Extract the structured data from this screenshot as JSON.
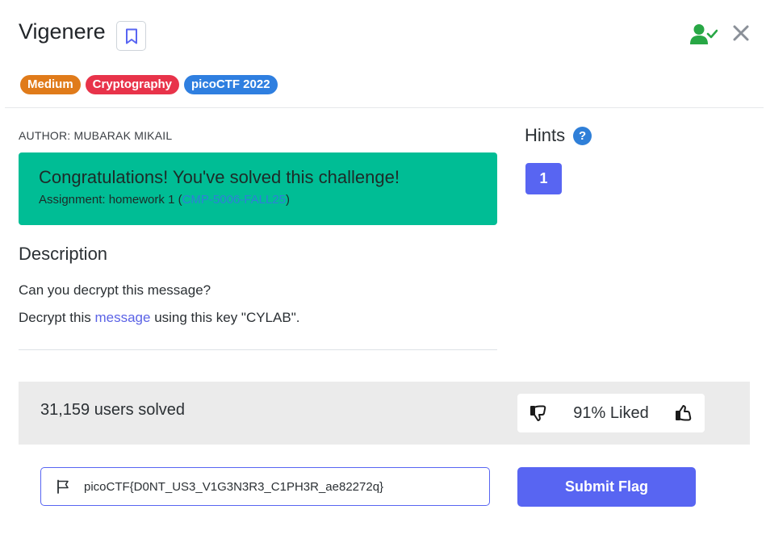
{
  "challenge": {
    "title": "Vigenere",
    "tags": [
      {
        "label": "Medium",
        "color": "#e07b1a"
      },
      {
        "label": "Cryptography",
        "color": "#e8334a"
      },
      {
        "label": "picoCTF 2022",
        "color": "#2f7fe0"
      }
    ],
    "author": "AUTHOR: MUBARAK MIKAIL"
  },
  "success": {
    "title": "Congratulations! You've solved this challenge!",
    "assignment_prefix": "Assignment: homework 1 (",
    "assignment_link": "CMP-5006-FALL25",
    "assignment_suffix": ")",
    "bg_color": "#00bd95"
  },
  "description": {
    "heading": "Description",
    "line1": "Can you decrypt this message?",
    "line2_prefix": "Decrypt this ",
    "line2_link": "message",
    "line2_suffix": " using this key \"CYLAB\"."
  },
  "hints": {
    "heading": "Hints",
    "help_icon": "question-circle-icon",
    "items": [
      "1"
    ]
  },
  "stats": {
    "solved": "31,159 users solved",
    "liked": "91% Liked"
  },
  "flag": {
    "value": "picoCTF{D0NT_US3_V1G3N3R3_C1PH3R_ae82272q}",
    "submit_label": "Submit Flag"
  },
  "icons": {
    "bookmark": "bookmark-icon",
    "user_check": "user-check-icon",
    "close": "close-icon",
    "flag": "flag-icon",
    "thumbs_down": "thumbs-down-icon",
    "thumbs_up": "thumbs-up-icon"
  },
  "colors": {
    "accent": "#5865f2",
    "user_check": "#28a745"
  }
}
